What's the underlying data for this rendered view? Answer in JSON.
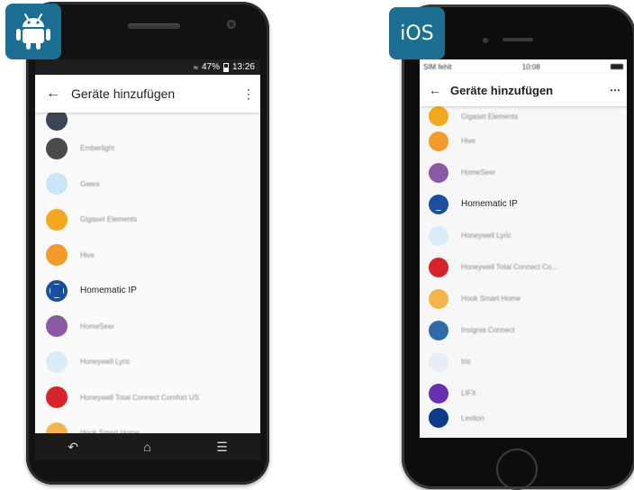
{
  "android": {
    "badge_icon": "android-robot-icon",
    "status": {
      "signal": "47%",
      "time": "13:26"
    },
    "appbar": {
      "back_icon": "arrow-left-icon",
      "title": "Geräte hinzufügen",
      "menu_icon": "more-vert-icon"
    },
    "devices": [
      {
        "name": "",
        "color": "#3a4656",
        "partial": true
      },
      {
        "name": "Emberlight",
        "color": "#4a4a4a"
      },
      {
        "name": "Geeni",
        "color": "#c9e6f6"
      },
      {
        "name": "Gigaset Elements",
        "color": "#f4a81e"
      },
      {
        "name": "Hive",
        "color": "#f39a2b"
      },
      {
        "name": "Homematic IP",
        "color": "#1a4fa0",
        "highlight": true
      },
      {
        "name": "HomeSeer",
        "color": "#8a5aa6"
      },
      {
        "name": "Honeywell Lyric",
        "color": "#d9ecf8"
      },
      {
        "name": "Honeywell Total Connect Comfort US",
        "color": "#d8232a"
      },
      {
        "name": "Hook Smart Home",
        "color": "#f4b54a"
      }
    ],
    "nav": {
      "back_icon": "nav-back-icon",
      "home_icon": "nav-home-icon",
      "menu_icon": "nav-menu-icon"
    }
  },
  "ios": {
    "badge_label": "iOS",
    "status": {
      "carrier": "SIM fehlt",
      "time": "10:08"
    },
    "appbar": {
      "back_icon": "arrow-left-icon",
      "title": "Geräte hinzufügen",
      "menu_icon": "more-horiz-icon"
    },
    "devices": [
      {
        "name": "Gigaset Elements",
        "color": "#f4a81e",
        "partial": true
      },
      {
        "name": "Hive",
        "color": "#f39a2b"
      },
      {
        "name": "HomeSeer",
        "color": "#8a5aa6"
      },
      {
        "name": "Homematic IP",
        "color": "#1a4fa0",
        "highlight": true
      },
      {
        "name": "Honeywell Lyric",
        "color": "#d9ecf8"
      },
      {
        "name": "Honeywell Total Connect Co...",
        "color": "#d8232a"
      },
      {
        "name": "Hook Smart Home",
        "color": "#f4b54a"
      },
      {
        "name": "Insignia Connect",
        "color": "#2f6aa8"
      },
      {
        "name": "Iris",
        "color": "#e8eef6"
      },
      {
        "name": "LIFX",
        "color": "#6a2fb0"
      },
      {
        "name": "Leviton",
        "color": "#0d3a8a",
        "partial": true
      }
    ]
  }
}
